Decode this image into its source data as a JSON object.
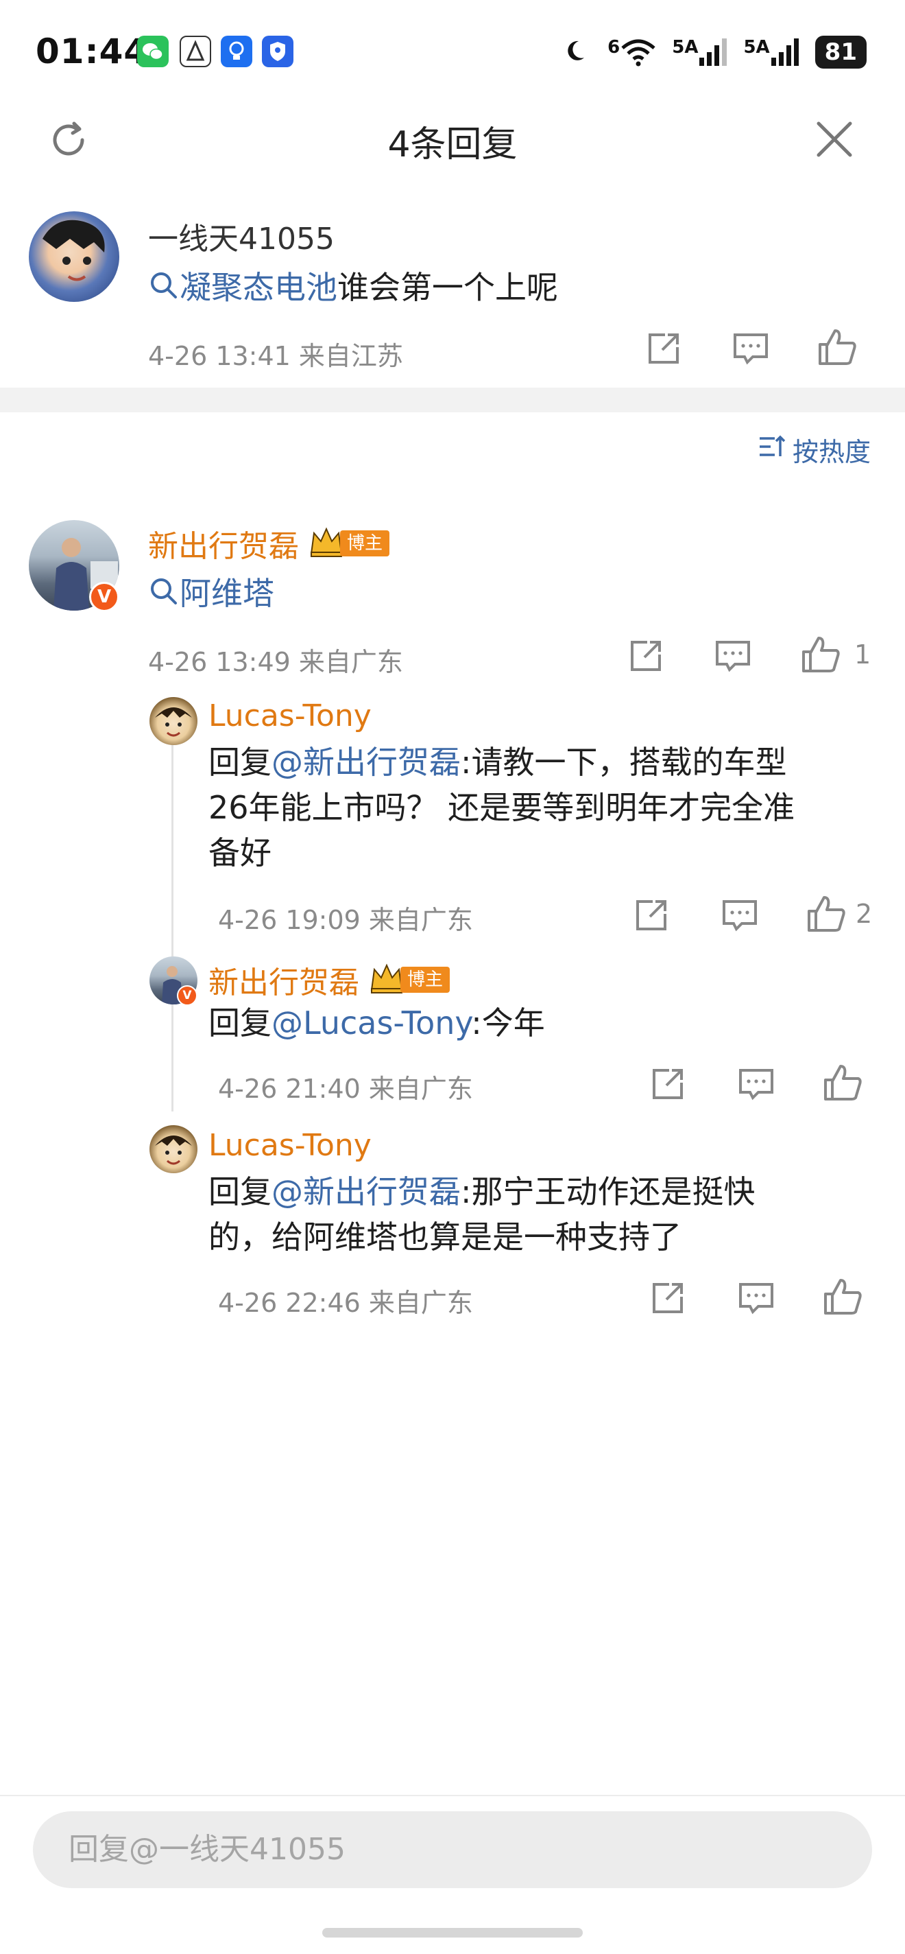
{
  "status_bar": {
    "time": "01:44",
    "signal1": "5A",
    "signal2": "5A",
    "wifi_label": "6",
    "battery": "81",
    "icons": [
      "wechat-icon",
      "assistant-icon",
      "bulb-icon",
      "shield-icon",
      "moon-icon",
      "wifi-icon",
      "signal-icon",
      "battery-icon"
    ]
  },
  "header": {
    "title": "4条回复",
    "refresh_icon": "refresh-icon",
    "close_icon": "close-icon"
  },
  "root_comment": {
    "user": "一线天41055",
    "topic": "凝聚态电池",
    "text": "谁会第一个上呢",
    "meta": "4-26 13:41 来自江苏"
  },
  "sort": {
    "label": "按热度"
  },
  "replies": [
    {
      "user": "新出行贺磊",
      "badge": "博主",
      "topic": "阿维塔",
      "meta": "4-26 13:49 来自广东",
      "likes": "1"
    },
    {
      "user": "Lucas-Tony",
      "reply_prefix": "回复",
      "mention": "@新出行贺磊",
      "text": ":请教一下，搭载的车型",
      "text2": "26年能上市吗？ 还是要等到明年才完全准",
      "text3": "备好",
      "meta": "4-26 19:09 来自广东",
      "likes": "2"
    },
    {
      "user": "新出行贺磊",
      "badge": "博主",
      "reply_prefix": "回复",
      "mention": "@Lucas-Tony",
      "text": ":今年",
      "meta": "4-26 21:40 来自广东"
    },
    {
      "user": "Lucas-Tony",
      "reply_prefix": "回复",
      "mention": "@新出行贺磊",
      "text": ":那宁王动作还是挺快",
      "text2": "的，给阿维塔也算是是一种支持了",
      "meta": "4-26 22:46 来自广东"
    }
  ],
  "input": {
    "placeholder": "回复@一线天41055"
  },
  "colors": {
    "accent_orange": "#e07912",
    "link_blue": "#3d6aa8",
    "meta_gray": "#8a8a8a"
  }
}
